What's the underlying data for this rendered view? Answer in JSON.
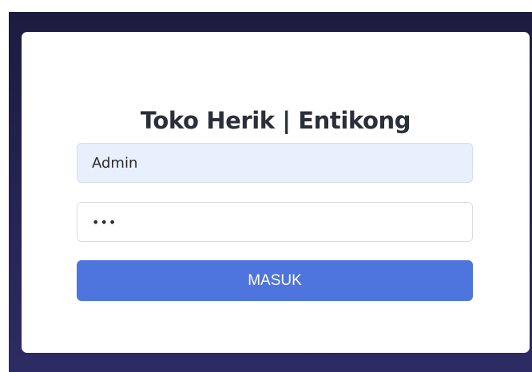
{
  "login": {
    "title": "Toko Herik | Entikong",
    "username_value": "Admin",
    "password_value": "•••",
    "submit_label": "MASUK"
  },
  "colors": {
    "background": "#242353",
    "card": "#ffffff",
    "title": "#2a2f3a",
    "autofill_field": "#e8f0fe",
    "primary_button": "#4e75dd",
    "button_text": "#ffffff"
  }
}
